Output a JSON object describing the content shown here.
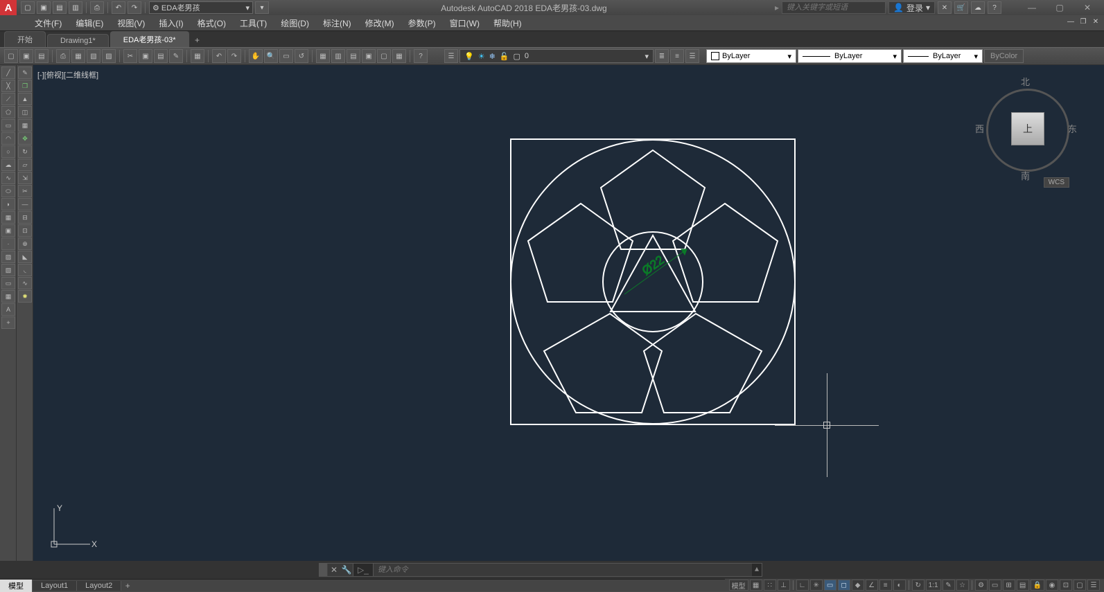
{
  "app": {
    "title": "Autodesk AutoCAD 2018    EDA老男孩-03.dwg"
  },
  "workspace": {
    "selected": "EDA老男孩"
  },
  "search": {
    "placeholder": "键入关键字或短语"
  },
  "login": {
    "label": "登录"
  },
  "menus": [
    "文件(F)",
    "编辑(E)",
    "视图(V)",
    "插入(I)",
    "格式(O)",
    "工具(T)",
    "绘图(D)",
    "标注(N)",
    "修改(M)",
    "参数(P)",
    "窗口(W)",
    "帮助(H)"
  ],
  "tabs": {
    "start": "开始",
    "docs": [
      "Drawing1*",
      "EDA老男孩-03*"
    ],
    "active": 1
  },
  "layer": {
    "current": "0"
  },
  "props": {
    "color": "ByLayer",
    "linetype": "ByLayer",
    "lineweight": "ByLayer",
    "plotstyle": "ByColor"
  },
  "viewport": {
    "label": "[-][俯视][二维线框]"
  },
  "viewcube": {
    "n": "北",
    "s": "南",
    "e": "东",
    "w": "西",
    "top": "上",
    "cs": "WCS"
  },
  "dimension": {
    "text": "Ø22"
  },
  "cmd": {
    "placeholder": "键入命令"
  },
  "layouts": {
    "tabs": [
      "模型",
      "Layout1",
      "Layout2"
    ],
    "active": 0
  },
  "status": {
    "model": "模型",
    "scale": "1:1"
  },
  "ucs": {
    "x": "X",
    "y": "Y"
  }
}
